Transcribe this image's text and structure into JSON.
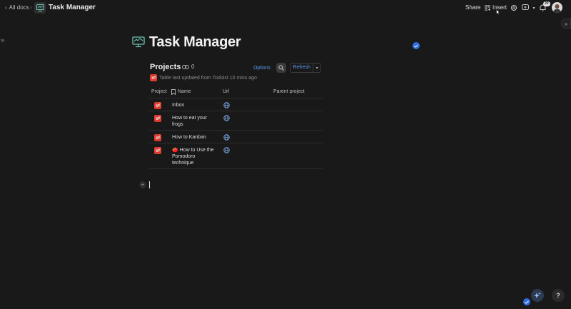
{
  "topbar": {
    "back_label": "All docs",
    "separator": "›",
    "doc_title": "Task Manager",
    "share_label": "Share",
    "insert_label": "Insert",
    "notification_badge": "20"
  },
  "page": {
    "title": "Task Manager"
  },
  "table": {
    "title": "Projects",
    "link_count": "0",
    "options_label": "Options",
    "refresh_label": "Refresh",
    "updated_text": "Table last updated from Todoist 10 mins ago",
    "columns": [
      "Project",
      "Name",
      "Url",
      "Parent project"
    ],
    "rows": [
      {
        "name": "Inbox"
      },
      {
        "name": "How to eat your frogs"
      },
      {
        "name": "How to Kanban"
      },
      {
        "name": "🍅 How to Use the Pomodoro technique"
      }
    ]
  },
  "colors": {
    "background": "#191919",
    "accent": "#2f6fe0",
    "link": "#5b9bf0",
    "todoist_red": "#dc3a2f"
  }
}
